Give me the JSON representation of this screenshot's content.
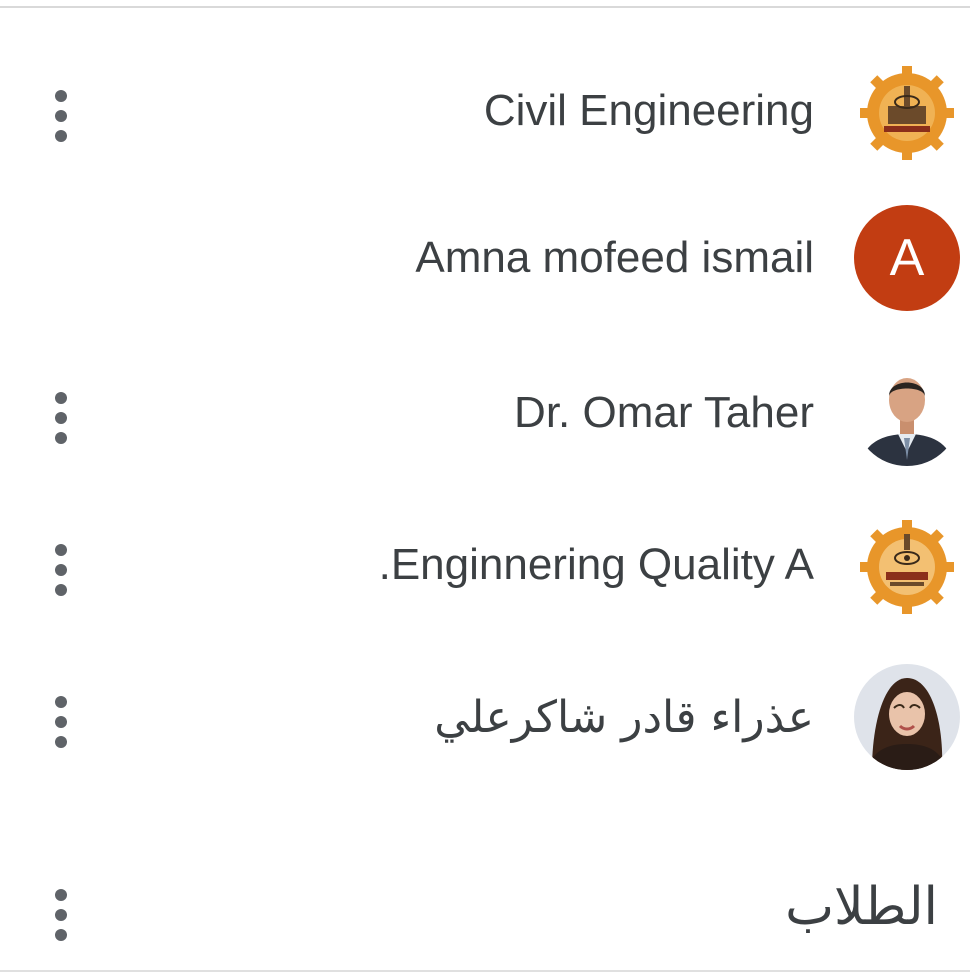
{
  "people": [
    {
      "name": "Civil Engineering",
      "avatar": "logo-gear-emblem",
      "menu": true
    },
    {
      "name": "Amna mofeed ismail",
      "avatar": "letter",
      "avatar_letter": "A",
      "avatar_color": "#c23d12",
      "menu": false
    },
    {
      "name": "Dr. Omar Taher",
      "avatar": "photo-man-suit",
      "menu": true
    },
    {
      "name": ".Enginnering Quality A",
      "avatar": "logo-gear-emblem",
      "menu": true
    },
    {
      "name": "عذراء قادر شاكرعلي",
      "avatar": "photo-woman",
      "menu": true
    }
  ],
  "students_section": {
    "title": "الطلاب"
  },
  "colors": {
    "text": "#3c4043",
    "icon": "#5f6368",
    "gear_orange": "#e8962a",
    "letter_avatar": "#c23d12"
  }
}
